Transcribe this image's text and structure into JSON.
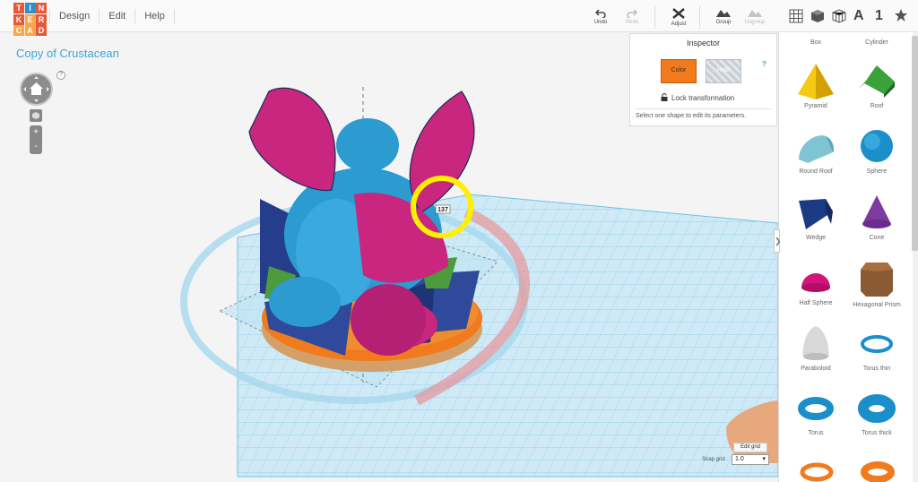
{
  "app": {
    "logo_letters": [
      "T",
      "I",
      "N",
      "K",
      "E",
      "R",
      "C",
      "A",
      "D"
    ],
    "logo_colors": [
      "#e55839",
      "#2e8fce",
      "#e55839",
      "#e55839",
      "#f7a64a",
      "#e55839",
      "#f7a64a",
      "#f7a64a",
      "#e55839"
    ]
  },
  "menu": {
    "items": [
      "Design",
      "Edit",
      "Help"
    ]
  },
  "toolbar": {
    "undo": "Undo",
    "redo": "Redo",
    "adjust": "Adjust",
    "group": "Group",
    "ungroup": "Ungroup"
  },
  "right_toolbar": {
    "text_tool": "A",
    "number_tool": "1"
  },
  "design": {
    "title": "Copy of Crustacean",
    "help": "?"
  },
  "inspector": {
    "title": "Inspector",
    "color_label": "Color",
    "hole_label": "Hole",
    "help": "?",
    "lock_label": "Lock transformation",
    "note": "Select one shape to edit its parameters."
  },
  "viewport": {
    "rotation_readout": "137",
    "edit_grid": "Edit grid",
    "snap_label": "Snap grid",
    "snap_value": "1.0",
    "side_tab": "❯"
  },
  "shapes": {
    "box": "Box",
    "cylinder": "Cylinder",
    "pyramid": "Pyramid",
    "roof": "Roof",
    "round_roof": "Round Roof",
    "sphere": "Sphere",
    "wedge": "Wedge",
    "cone": "Cone",
    "half_sphere": "Half Sphere",
    "hexagonal_prism": "Hexagonal Prism",
    "paraboloid": "Paraboloid",
    "torus_thin": "Torus thin",
    "torus": "Torus",
    "torus_thick": "Torus thick"
  },
  "colors": {
    "accent": "#39a7d8",
    "magenta": "#c8267f",
    "blue": "#2b9bd0",
    "navy": "#263d8c",
    "orange": "#f07a1c",
    "highlight": "#ffef00"
  }
}
